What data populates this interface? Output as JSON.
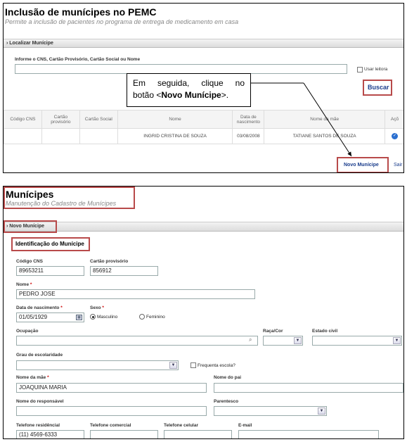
{
  "top": {
    "title": "Inclusão de munícipes no PEMC",
    "subtitle": "Permite a inclusão de pacientes no programa de entrega de medicamento em casa",
    "section": "Localizar Munícipe",
    "search_label": "Informe o CNS, Cartão Provisório, Cartão Social ou Nome",
    "search_value": "",
    "usar_leitora": "Usar leitora",
    "buscar": "Buscar",
    "columns": [
      "Código CNS",
      "Cartão provisório",
      "Cartão Social",
      "Nome",
      "Data de nascimento",
      "Nome da mãe",
      "Açõ"
    ],
    "row": [
      "",
      "",
      "",
      "INGRID CRISTINA DE SOUZA",
      "03/08/2008",
      "TATIANE SANTOS DE SOUZA",
      ""
    ],
    "novo_municipe": "Novo Munícipe",
    "sair": "Sair"
  },
  "callout": {
    "line1": "Em seguida, clique no",
    "prefix": "botão <",
    "bold": "Novo Munícipe",
    "suffix": ">."
  },
  "bottom": {
    "title": "Munícipes",
    "subtitle": "Manutenção do Cadastro de Munícipes",
    "section": "Novo Munícipe",
    "identificacao": "Identificação do Munícipe",
    "codigo_cns_label": "Código CNS",
    "codigo_cns_value": "89653211",
    "cartao_label": "Cartão provisório",
    "cartao_value": "856912",
    "nome_label": "Nome",
    "nome_value": "PEDRO JOSE",
    "nascimento_label": "Data de nascimento",
    "nascimento_value": "01/05/1929",
    "sexo_label": "Sexo",
    "masculino": "Masculino",
    "feminino": "Feminino",
    "ocupacao_label": "Ocupação",
    "raca_label": "Raça/Cor",
    "estado_civil_label": "Estado civil",
    "grau_label": "Grau de escolaridade",
    "frequenta": "Frequenta escola?",
    "mae_label": "Nome da mãe",
    "mae_value": "JOAQUINA MARIA",
    "pai_label": "Nome do pai",
    "responsavel_label": "Nome do responsável",
    "parentesco_label": "Parentesco",
    "tel_res_label": "Telefone residêncial",
    "tel_res_value": "(11) 4569-6333",
    "tel_com_label": "Telefone comercial",
    "tel_cel_label": "Telefone celular",
    "email_label": "E-mail"
  },
  "colors": {
    "accent_red": "#b84a4a",
    "link_blue": "#1b3d8c"
  }
}
